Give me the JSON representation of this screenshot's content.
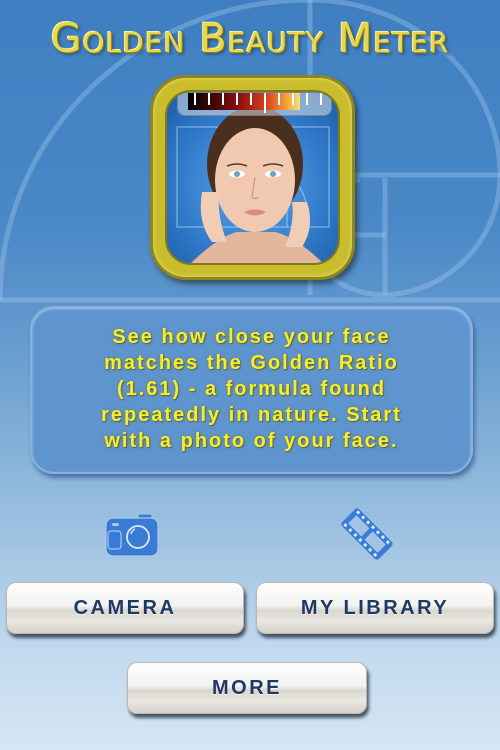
{
  "app": {
    "title": "Golden Beauty Meter"
  },
  "logo": {
    "icon": "face-meter-logo",
    "meter_ticks": 10
  },
  "description": {
    "lines": [
      "See how close your face",
      "matches the Golden Ratio",
      "(1.61) - a formula found",
      "repeatedly in nature. Start",
      "with a photo of your face."
    ]
  },
  "icons": {
    "camera": "camera-icon",
    "library": "film-strip-icon"
  },
  "buttons": {
    "camera_label": "CAMERA",
    "library_label": "MY LIBRARY",
    "more_label": "MORE"
  },
  "colors": {
    "title_gold": "#e9d74a",
    "text_yellow": "#f4ef2a",
    "icon_blue": "#3a7bd5",
    "button_text": "#1c3a64",
    "frame_gold": "#c9bd2c"
  }
}
